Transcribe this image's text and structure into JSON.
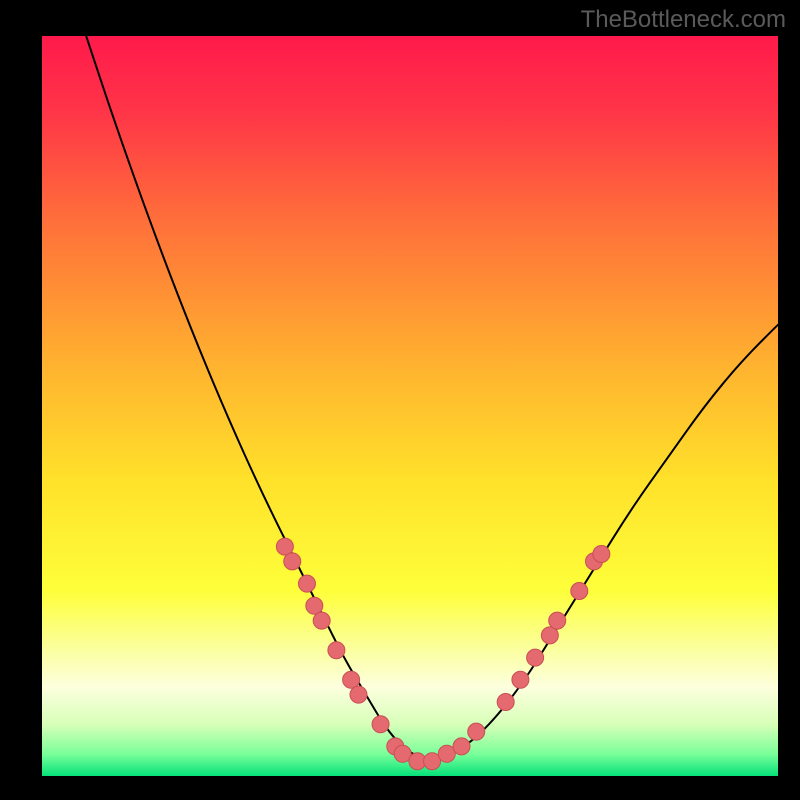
{
  "watermark": "TheBottleneck.com",
  "colors": {
    "frame": "#000000",
    "gradient_stops": [
      {
        "pct": 0,
        "color": "#ff1a4b"
      },
      {
        "pct": 10,
        "color": "#ff3448"
      },
      {
        "pct": 25,
        "color": "#ff6f3a"
      },
      {
        "pct": 45,
        "color": "#ffb42f"
      },
      {
        "pct": 60,
        "color": "#ffe12a"
      },
      {
        "pct": 75,
        "color": "#feff3a"
      },
      {
        "pct": 83,
        "color": "#fbffa0"
      },
      {
        "pct": 88,
        "color": "#fdffde"
      },
      {
        "pct": 93,
        "color": "#d7ffb8"
      },
      {
        "pct": 97,
        "color": "#7bff9a"
      },
      {
        "pct": 100,
        "color": "#05e27a"
      }
    ],
    "curve": "#000000",
    "dot_fill": "#e46a6f",
    "dot_stroke": "#c94f55"
  },
  "chart_data": {
    "type": "line",
    "title": "",
    "xlabel": "",
    "ylabel": "",
    "xlim": [
      0,
      100
    ],
    "ylim": [
      0,
      100
    ],
    "grid": false,
    "legend": false,
    "series": [
      {
        "name": "bottleneck-curve",
        "x": [
          6,
          10,
          15,
          20,
          25,
          30,
          35,
          38,
          41,
          44,
          47,
          50,
          53,
          56,
          60,
          65,
          70,
          75,
          80,
          85,
          90,
          95,
          100
        ],
        "y": [
          100,
          88,
          74,
          61,
          49,
          38,
          28,
          22,
          16,
          11,
          6,
          3,
          2,
          3,
          6,
          12,
          20,
          28,
          36,
          43,
          50,
          56,
          61
        ]
      }
    ],
    "scatter_points": {
      "name": "highlighted-points",
      "points": [
        {
          "x": 33,
          "y": 31
        },
        {
          "x": 34,
          "y": 29
        },
        {
          "x": 36,
          "y": 26
        },
        {
          "x": 37,
          "y": 23
        },
        {
          "x": 38,
          "y": 21
        },
        {
          "x": 40,
          "y": 17
        },
        {
          "x": 42,
          "y": 13
        },
        {
          "x": 43,
          "y": 11
        },
        {
          "x": 46,
          "y": 7
        },
        {
          "x": 48,
          "y": 4
        },
        {
          "x": 49,
          "y": 3
        },
        {
          "x": 51,
          "y": 2
        },
        {
          "x": 53,
          "y": 2
        },
        {
          "x": 55,
          "y": 3
        },
        {
          "x": 57,
          "y": 4
        },
        {
          "x": 59,
          "y": 6
        },
        {
          "x": 63,
          "y": 10
        },
        {
          "x": 65,
          "y": 13
        },
        {
          "x": 67,
          "y": 16
        },
        {
          "x": 69,
          "y": 19
        },
        {
          "x": 70,
          "y": 21
        },
        {
          "x": 73,
          "y": 25
        },
        {
          "x": 75,
          "y": 29
        },
        {
          "x": 76,
          "y": 30
        }
      ]
    }
  }
}
